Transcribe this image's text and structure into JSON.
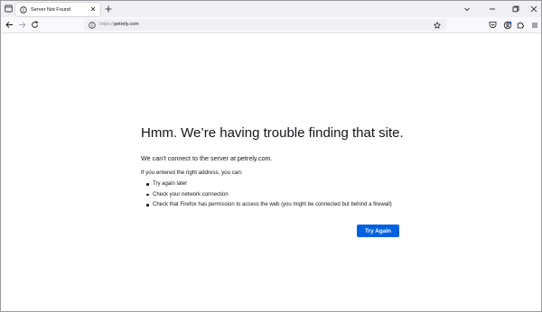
{
  "browser": {
    "tab": {
      "title": "Server Not Found",
      "icon": "info-icon"
    },
    "address_bar": {
      "scheme": "https://",
      "host": "petrely.com"
    }
  },
  "page": {
    "title": "Hmm. We’re having trouble finding that site.",
    "short_description": "We can’t connect to the server at petrely.com.",
    "long_description_heading": "If you entered the right address, you can:",
    "suggestions": [
      "Try again later",
      "Check your network connection",
      "Check that Firefox has permission to access the web (you might be connected but behind a firewall)"
    ],
    "try_again_label": "Try Again"
  },
  "colors": {
    "accent": "#0061e0",
    "tabstrip_bg": "#f0f0f4",
    "toolbar_bg": "#f9f9fb",
    "text": "#15141a",
    "url_scheme": "#8f8f9d"
  }
}
